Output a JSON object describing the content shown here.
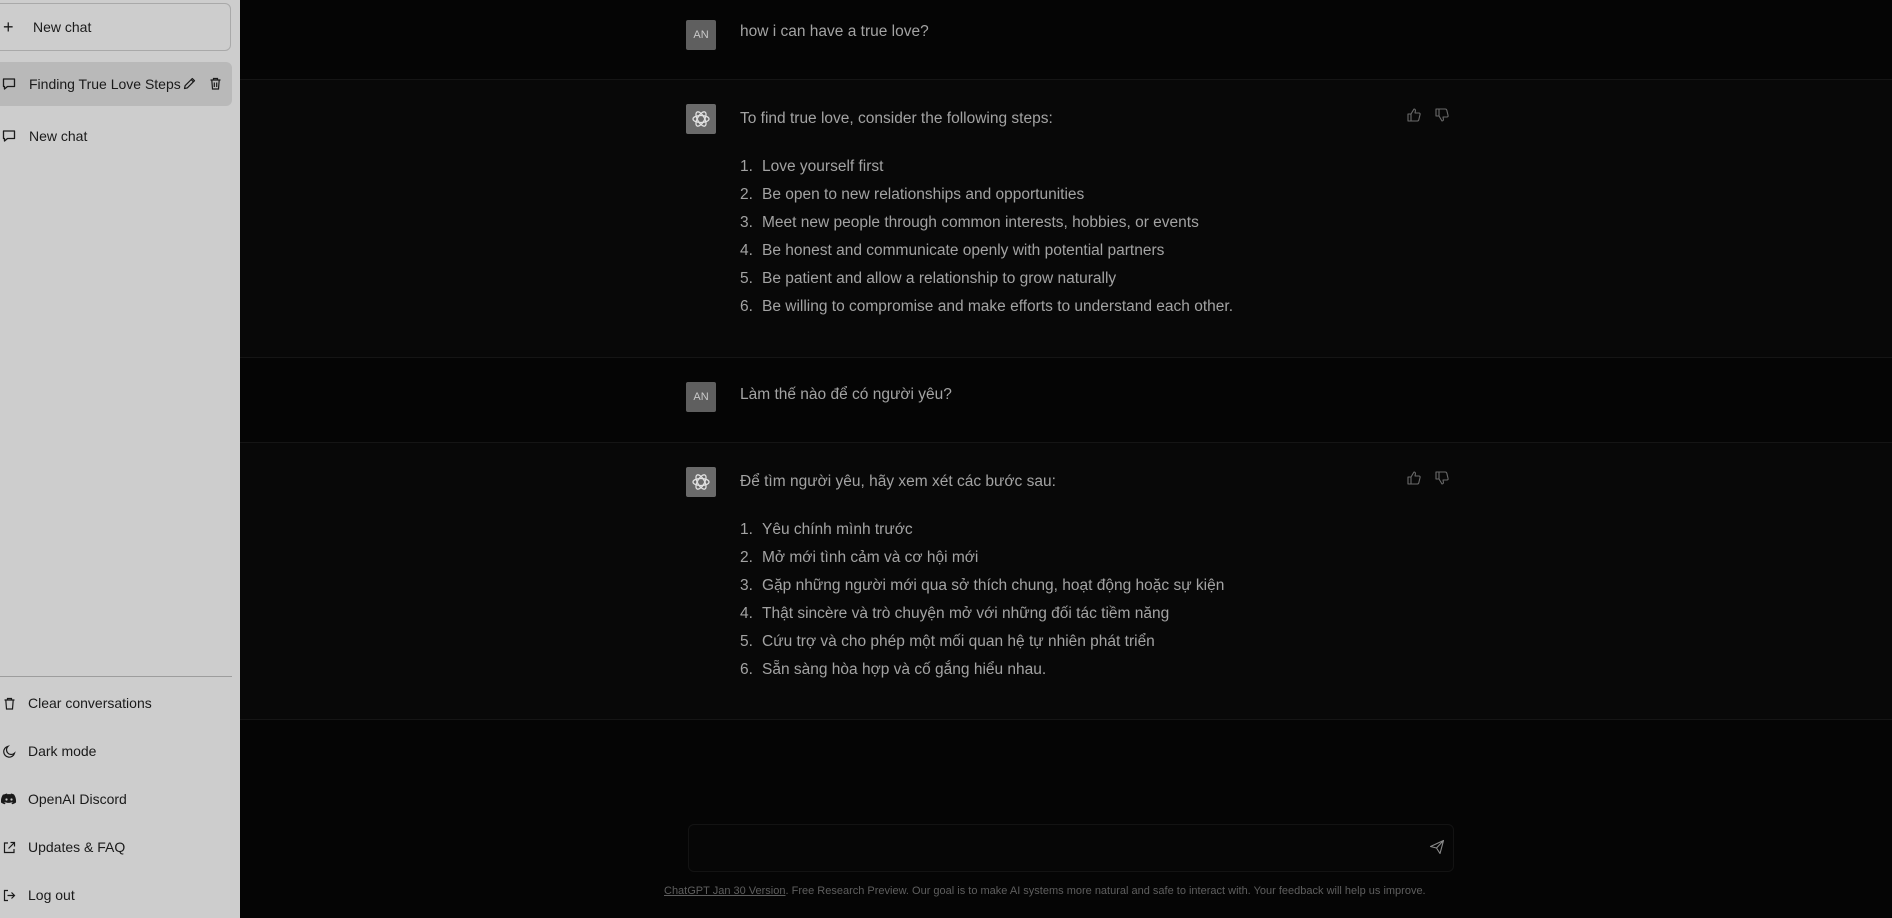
{
  "sidebar": {
    "new_chat_label": "New chat",
    "chats": [
      {
        "label": "Finding True Love Steps",
        "active": true
      },
      {
        "label": "New chat",
        "active": false
      }
    ],
    "menu": {
      "clear": "Clear conversations",
      "dark_mode": "Dark mode",
      "discord": "OpenAI Discord",
      "updates": "Updates & FAQ",
      "logout": "Log out"
    }
  },
  "conversation": {
    "user_initials": "AN",
    "messages": [
      {
        "role": "user",
        "text": "how i can have a true love?"
      },
      {
        "role": "assistant",
        "intro": "To find true love, consider the following steps:",
        "steps": [
          "Love yourself first",
          "Be open to new relationships and opportunities",
          "Meet new people through common interests, hobbies, or events",
          "Be honest and communicate openly with potential partners",
          "Be patient and allow a relationship to grow naturally",
          "Be willing to compromise and make efforts to understand each other."
        ]
      },
      {
        "role": "user",
        "text": "Làm thế nào để có người yêu?"
      },
      {
        "role": "assistant",
        "intro": "Để tìm người yêu, hãy xem xét các bước sau:",
        "steps": [
          "Yêu chính mình trước",
          "Mở mới tình cảm và cơ hội mới",
          "Gặp những người mới qua sở thích chung, hoạt động hoặc sự kiện",
          "Thật sincère và trò chuyện mở với những đối tác tiềm năng",
          "Cứu trợ và cho phép một mối quan hệ tự nhiên phát triển",
          "Sẵn sàng hòa hợp và cố gắng hiểu nhau."
        ]
      }
    ]
  },
  "composer": {
    "placeholder": "",
    "value": ""
  },
  "footer": {
    "version_link": "ChatGPT Jan 30 Version",
    "text": ". Free Research Preview. Our goal is to make AI systems more natural and safe to interact with. Your feedback will help us improve."
  },
  "colors": {
    "sidebar_bg": "#cdcdcd",
    "main_bg": "#050505",
    "active_chat_bg": "#b9b9b9"
  }
}
